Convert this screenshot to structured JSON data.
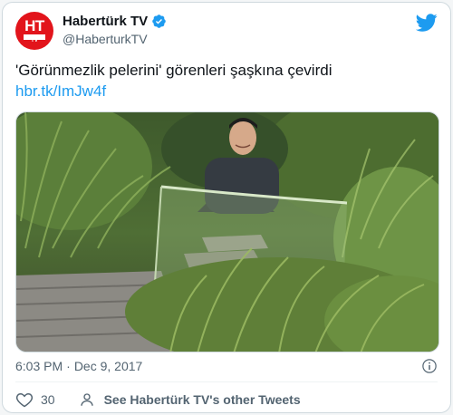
{
  "account": {
    "display_name": "Habertürk TV",
    "handle": "@HaberturkTV",
    "avatar_text": "HT",
    "avatar_subtext": "TV"
  },
  "tweet": {
    "text": "'Görünmezlik pelerini' görenleri şaşkına çevirdi",
    "link": "hbr.tk/ImJw4f",
    "time": "6:03 PM",
    "separator": "·",
    "date": "Dec 9, 2017"
  },
  "actions": {
    "likes": "30",
    "see_more": "See Habertürk TV's other Tweets"
  },
  "colors": {
    "brand_red": "#e2141b",
    "link_blue": "#1d9bf0",
    "muted": "#536471",
    "border": "#cfd9de"
  },
  "icons": {
    "verified": "verified-badge-icon",
    "logo": "twitter-bird-icon",
    "info": "info-icon",
    "like": "heart-icon",
    "profile": "person-icon"
  }
}
